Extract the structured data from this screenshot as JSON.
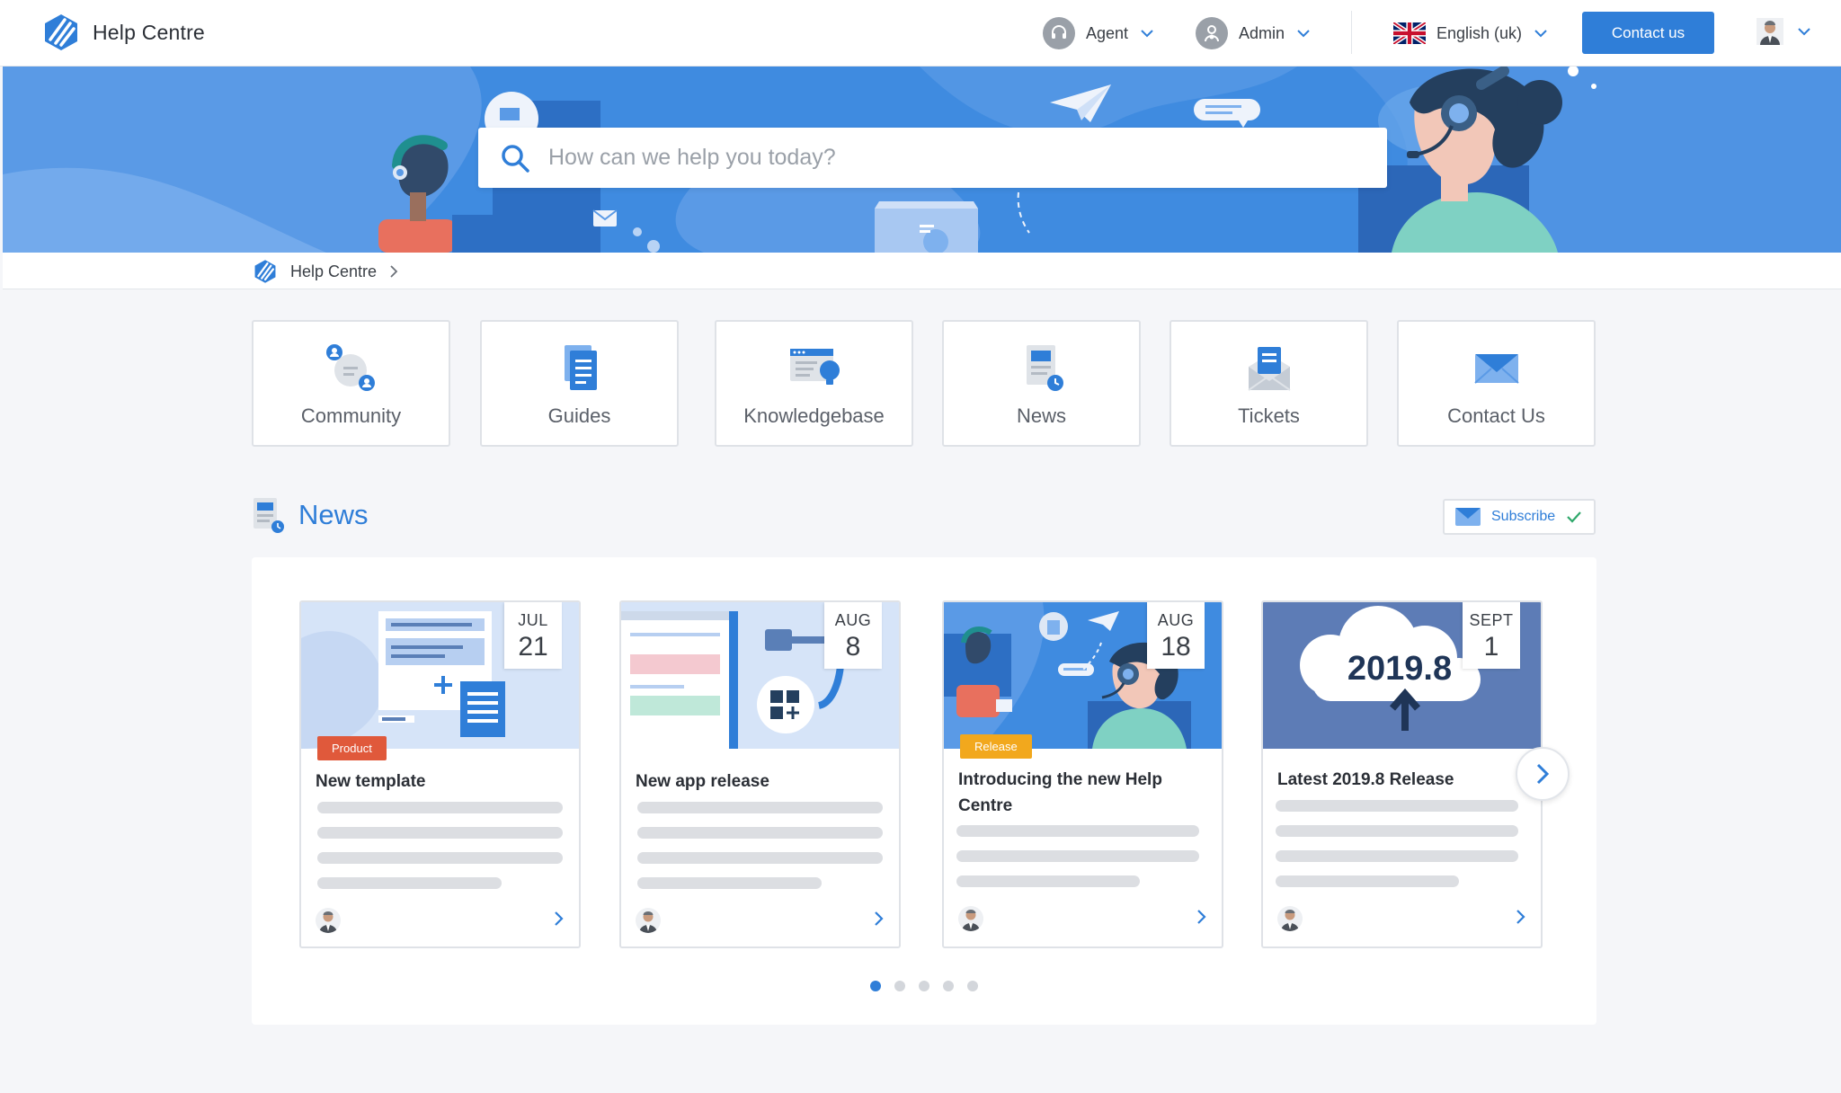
{
  "header": {
    "app_title": "Help Centre",
    "agent_label": "Agent",
    "admin_label": "Admin",
    "language_label": "English (uk)",
    "contact_button": "Contact us"
  },
  "hero": {
    "search_placeholder": "How can we help you today?",
    "search_value": ""
  },
  "breadcrumb": {
    "items": [
      "Help Centre"
    ]
  },
  "categories": [
    {
      "label": "Community",
      "icon": "community-icon"
    },
    {
      "label": "Guides",
      "icon": "guides-icon"
    },
    {
      "label": "Knowledgebase",
      "icon": "knowledgebase-icon"
    },
    {
      "label": "News",
      "icon": "news-icon"
    },
    {
      "label": "Tickets",
      "icon": "tickets-icon"
    },
    {
      "label": "Contact Us",
      "icon": "contact-us-icon"
    }
  ],
  "news": {
    "title": "News",
    "subscribe_label": "Subscribe",
    "cards": [
      {
        "month": "JUL",
        "day": "21",
        "tag": "Product",
        "title": "New template"
      },
      {
        "month": "AUG",
        "day": "8",
        "tag": "",
        "title": "New app release"
      },
      {
        "month": "AUG",
        "day": "18",
        "tag": "Release",
        "title": "Introducing the new Help Centre"
      },
      {
        "month": "SEPT",
        "day": "1",
        "tag": "",
        "title": "Latest 2019.8 Release",
        "image_text": "2019.8"
      }
    ],
    "pagination": {
      "total": 5,
      "active": 1
    }
  },
  "colors": {
    "accent": "#2f7ed8",
    "hero_blue": "#3f8be0",
    "tag_product": "#e0593b",
    "tag_release": "#f2a81d"
  }
}
